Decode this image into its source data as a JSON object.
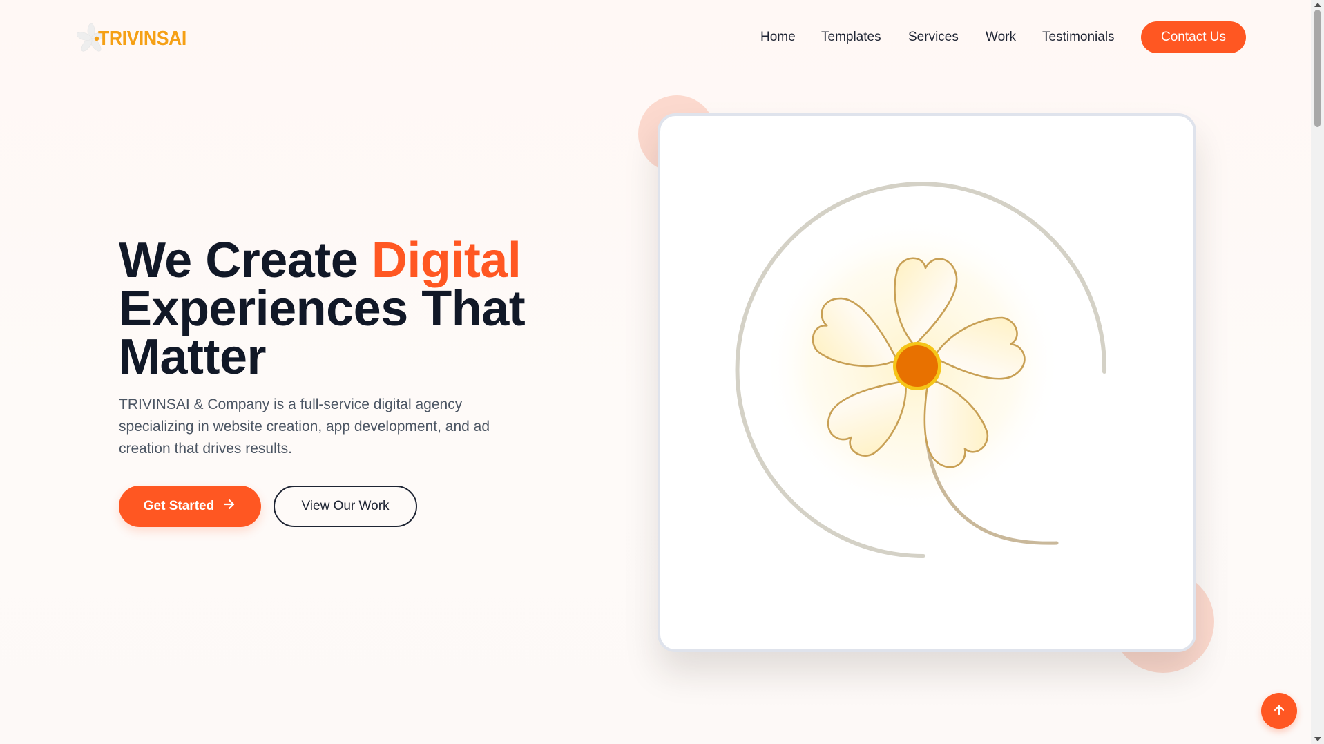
{
  "brand": {
    "name": "TRIVINSAI",
    "accent_color": "#ff5722",
    "logo_color": "#f5a015",
    "icon": "plumeria-flower-icon"
  },
  "nav": {
    "links": [
      "Home",
      "Templates",
      "Services",
      "Work",
      "Testimonials"
    ],
    "contact_label": "Contact Us"
  },
  "hero": {
    "title_part1": "We Create ",
    "title_accent": "Digital",
    "title_part2": "Experiences That Matter",
    "description": "TRIVINSAI & Company is a full-service digital agency specializing in website creation, app development, and ad creation that drives results.",
    "primary_button": "Get Started",
    "primary_icon": "arrow-right-icon",
    "secondary_button": "View Our Work"
  },
  "illustration": {
    "icon": "plumeria-flower-illustration",
    "petal_color": "#c8a055",
    "center_color": "#e87100",
    "ring_color": "#f5c518",
    "arc_color": "#d4d1c6"
  },
  "scroll_top": {
    "icon": "arrow-up-icon"
  }
}
